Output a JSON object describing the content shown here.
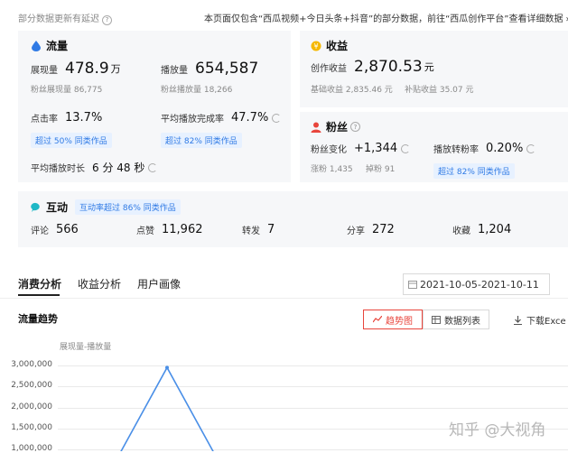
{
  "topbar": {
    "left_text": "部分数据更新有延迟",
    "right_text": "本页面仅包含“西瓜视频+今日头条+抖音”的部分数据，前往“西瓜创作平台”查看详细数据",
    "right_arrow": "›"
  },
  "traffic": {
    "title": "流量",
    "exposure_label": "展现量",
    "exposure_value": "478.9",
    "exposure_unit": "万",
    "play_label": "播放量",
    "play_value": "654,587",
    "fan_exposure": "粉丝展现量 86,775",
    "fan_play": "粉丝播放量 18,266",
    "ctr_label": "点击率",
    "ctr_value": "13.7%",
    "ctr_badge": "超过 50% 同类作品",
    "completion_label": "平均播放完成率",
    "completion_value": "47.7%",
    "completion_badge": "超过 82% 同类作品",
    "duration_label": "平均播放时长",
    "duration_value": "6 分 48 秒"
  },
  "income": {
    "title": "收益",
    "creation_label": "创作收益",
    "creation_value": "2,870.53",
    "creation_unit": "元",
    "base": "基础收益 2,835.46 元",
    "subsidy": "补贴收益 35.07 元"
  },
  "fans": {
    "title": "粉丝",
    "change_label": "粉丝变化",
    "change_value": "+1,344",
    "conv_label": "播放转粉率",
    "conv_value": "0.20%",
    "gain": "涨粉 1,435",
    "loss": "掉粉 91",
    "conv_badge": "超过 82% 同类作品"
  },
  "interaction": {
    "title": "互动",
    "badge": "互动率超过 86% 同类作品",
    "comment_label": "评论",
    "comment_value": "566",
    "like_label": "点赞",
    "like_value": "11,962",
    "forward_label": "转发",
    "forward_value": "7",
    "share_label": "分享",
    "share_value": "272",
    "fav_label": "收藏",
    "fav_value": "1,204"
  },
  "tabs": [
    "消费分析",
    "收益分析",
    "用户画像"
  ],
  "date_range": "2021-10-05-2021-10-11",
  "trend": {
    "title": "流量趋势",
    "btn_chart": "趋势图",
    "btn_list": "数据列表",
    "btn_download": "下载Exce"
  },
  "watermark": "知乎 @大视角",
  "colors": {
    "accent_red": "#e8453c",
    "accent_blue": "#2f7ae5",
    "line_blue": "#4a8fe7"
  },
  "chart_data": {
    "type": "line",
    "legend": [
      "展现量-播放量"
    ],
    "ylim": [
      0,
      3000000
    ],
    "yticks": [
      "3,000,000",
      "2,500,000",
      "2,000,000",
      "1,500,000",
      "1,000,000"
    ],
    "series": [
      {
        "name": "展现量-播放量",
        "points": [
          [
            0,
            600000
          ],
          [
            1,
            2950000
          ],
          [
            2,
            600000
          ]
        ]
      }
    ]
  }
}
